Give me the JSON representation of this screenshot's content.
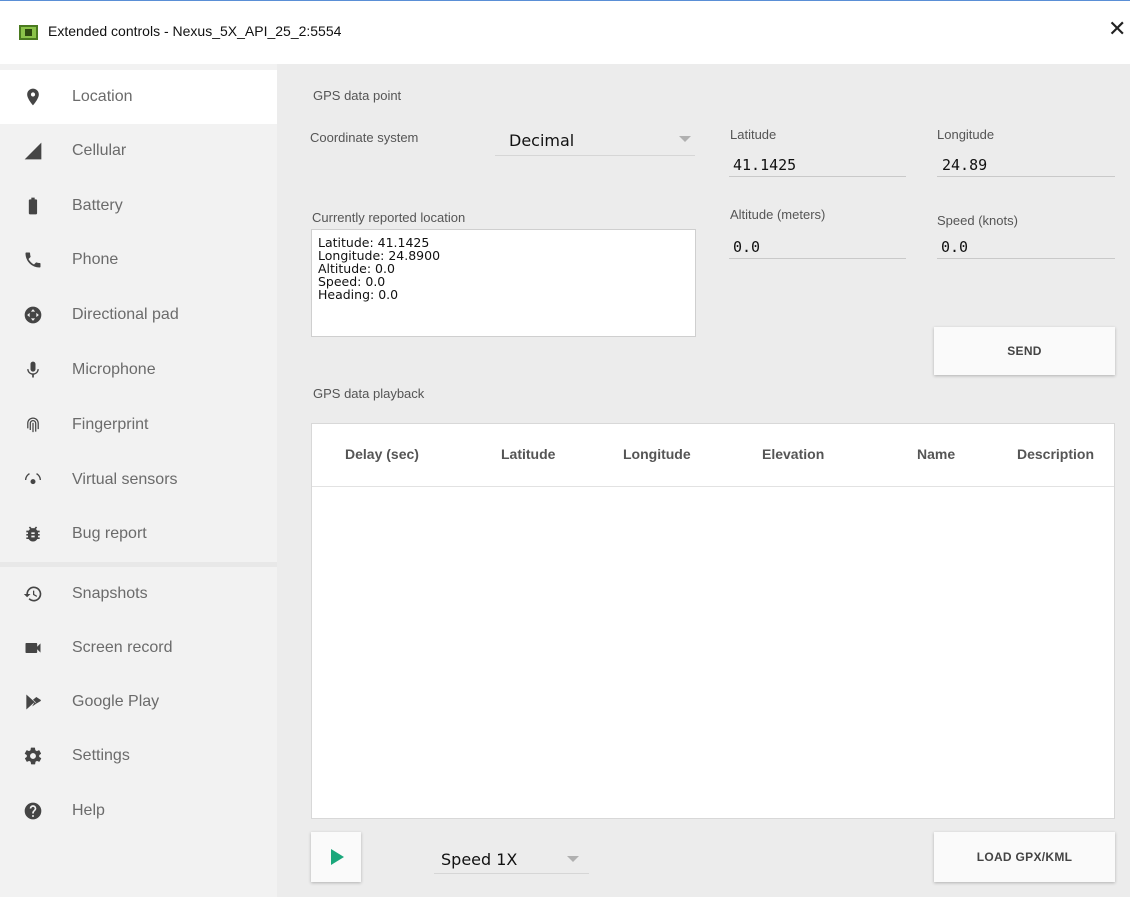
{
  "window": {
    "title": "Extended controls - Nexus_5X_API_25_2:5554",
    "close_glyph": "✕"
  },
  "sidebar": {
    "items": [
      {
        "label": "Location",
        "icon": "location-pin-icon",
        "active": true
      },
      {
        "label": "Cellular",
        "icon": "signal-icon"
      },
      {
        "label": "Battery",
        "icon": "battery-icon"
      },
      {
        "label": "Phone",
        "icon": "phone-icon"
      },
      {
        "label": "Directional pad",
        "icon": "dpad-icon"
      },
      {
        "label": "Microphone",
        "icon": "microphone-icon"
      },
      {
        "label": "Fingerprint",
        "icon": "fingerprint-icon"
      },
      {
        "label": "Virtual sensors",
        "icon": "rotation-icon"
      },
      {
        "label": "Bug report",
        "icon": "bug-icon"
      },
      {
        "label": "Snapshots",
        "icon": "history-icon"
      },
      {
        "label": "Screen record",
        "icon": "videocam-icon"
      },
      {
        "label": "Google Play",
        "icon": "play-store-icon"
      },
      {
        "label": "Settings",
        "icon": "gear-icon"
      },
      {
        "label": "Help",
        "icon": "help-icon"
      }
    ]
  },
  "gps_point": {
    "section_title": "GPS data point",
    "coordinate_system_label": "Coordinate system",
    "coordinate_system_value": "Decimal",
    "latitude_label": "Latitude",
    "latitude_value": "41.1425",
    "longitude_label": "Longitude",
    "longitude_value": "24.89",
    "altitude_label": "Altitude (meters)",
    "altitude_value": "0.0",
    "speed_label": "Speed (knots)",
    "speed_value": "0.0",
    "reported_label": "Currently reported location",
    "reported_lines": {
      "latitude": "Latitude: 41.1425",
      "longitude": "Longitude: 24.8900",
      "altitude": "Altitude: 0.0",
      "speed": "Speed: 0.0",
      "heading": "Heading: 0.0"
    },
    "send_label": "SEND"
  },
  "playback": {
    "section_title": "GPS data playback",
    "columns": {
      "delay": "Delay (sec)",
      "latitude": "Latitude",
      "longitude": "Longitude",
      "elevation": "Elevation",
      "name": "Name",
      "description": "Description"
    },
    "rows": [],
    "speed_value": "Speed 1X",
    "load_label": "LOAD GPX/KML"
  },
  "colors": {
    "accent_play": "#1aa77b",
    "sidebar_bg": "#f2f2f2",
    "main_bg": "#ececec",
    "title_border": "#5a8fd6"
  }
}
